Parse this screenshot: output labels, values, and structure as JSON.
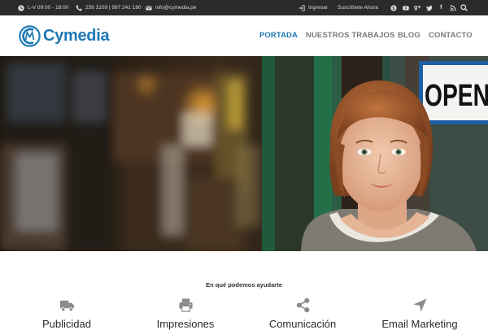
{
  "topbar": {
    "hours": "L-V 09:00 - 18:00",
    "phones": "256 3109 | 997 241 180",
    "email": "info@cymedia.pe",
    "login": "Ingresar",
    "subscribe": "Suscríbete Ahora",
    "social_icons": [
      "skype-icon",
      "youtube-icon",
      "google-plus-icon",
      "twitter-icon",
      "facebook-icon",
      "rss-icon"
    ],
    "google_plus_glyph": "g+",
    "facebook_glyph": "f"
  },
  "header": {
    "logo_text": "Cymedia",
    "nav": [
      "PORTADA",
      "NUESTROS TRABAJOS",
      "BLOG",
      "CONTACTO"
    ],
    "active_nav": "PORTADA"
  },
  "hero": {
    "sign_text": "OPEN"
  },
  "services": {
    "title": "En qué podemos ayudarte",
    "items": [
      {
        "label": "Publicidad",
        "icon": "truck-icon"
      },
      {
        "label": "Impresiones",
        "icon": "printer-icon"
      },
      {
        "label": "Comunicación",
        "icon": "share-icon"
      },
      {
        "label": "Email Marketing",
        "icon": "location-arrow-icon"
      }
    ]
  },
  "colors": {
    "brand": "#1e78b4",
    "topbar_bg": "#2b2b2b",
    "nav_text": "#7a7a7a"
  }
}
